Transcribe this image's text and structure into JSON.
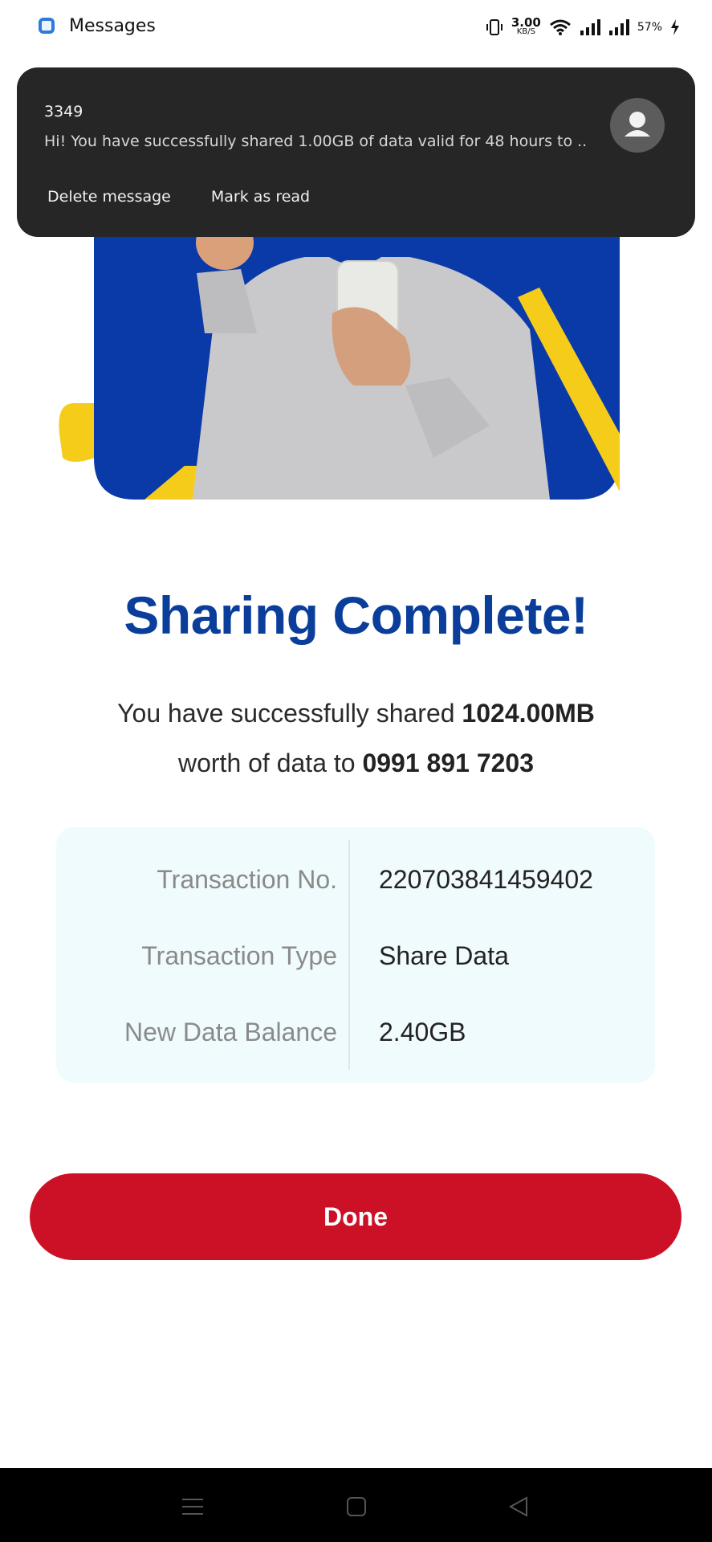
{
  "status_bar": {
    "app_name": "Messages",
    "net_speed_value": "3.00",
    "net_speed_unit": "KB/S",
    "battery": "57%"
  },
  "notification": {
    "sender": "3349",
    "body": "Hi! You have successfully shared 1.00GB of data valid for 48 hours to ..",
    "actions": [
      "Delete message",
      "Mark as read"
    ]
  },
  "main": {
    "title": "Sharing Complete!",
    "desc_prefix": "You have successfully shared",
    "shared_amount": "1024.00MB",
    "desc_middle": "worth of data to",
    "recipient": "0991 891 7203"
  },
  "details": [
    {
      "label": "Transaction No.",
      "value": "220703841459402"
    },
    {
      "label": "Transaction Type",
      "value": "Share Data"
    },
    {
      "label": "New Data Balance",
      "value": "2.40GB"
    }
  ],
  "done_label": "Done",
  "colors": {
    "title_blue": "#0b3e9b",
    "done_red": "#cc1127",
    "hero_blue": "#0a3aa8",
    "hero_yellow": "#f6cc1b",
    "card_bg": "#f0fbfd"
  },
  "icons": {
    "app": "messages-app-icon",
    "avatar": "person-avatar-icon",
    "nav": [
      "menu-lines-icon",
      "home-square-icon",
      "back-triangle-icon"
    ]
  }
}
